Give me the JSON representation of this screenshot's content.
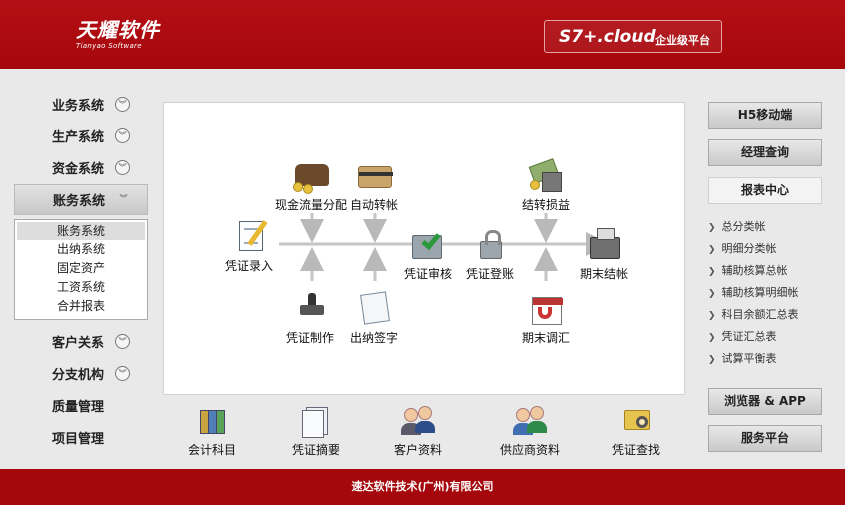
{
  "header": {
    "logo_cn": "天耀软件",
    "logo_en": "Tianyao Software",
    "product": "S7+.cloud",
    "platform": "企业级平台"
  },
  "nav": {
    "items": [
      {
        "label": "业务系统"
      },
      {
        "label": "生产系统"
      },
      {
        "label": "资金系统"
      },
      {
        "label": "账务系统",
        "active": true
      },
      {
        "label": "客户关系"
      },
      {
        "label": "分支机构"
      },
      {
        "label": "质量管理"
      },
      {
        "label": "项目管理"
      }
    ],
    "submenu": [
      "账务系统",
      "出纳系统",
      "固定资产",
      "工资系统",
      "合并报表"
    ]
  },
  "flow": {
    "voucher_entry": "凭证录入",
    "cash_flow": "现金流量分配",
    "auto_transfer": "自动转帐",
    "voucher_review": "凭证审核",
    "voucher_post": "凭证登账",
    "carry_forward": "结转损益",
    "period_close": "期末结帐",
    "voucher_make": "凭证制作",
    "cashier_sign": "出纳签字",
    "period_adjust": "期末调汇"
  },
  "quick": [
    "会计科目",
    "凭证摘要",
    "客户资料",
    "供应商资料",
    "凭证查找"
  ],
  "right": {
    "h5": "H5移动端",
    "manager": "经理查询",
    "report_center": "报表中心",
    "reports": [
      "总分类帐",
      "明细分类帐",
      "辅助核算总帐",
      "辅助核算明细帐",
      "科目余额汇总表",
      "凭证汇总表",
      "试算平衡表"
    ],
    "browser_app": "浏览器 & APP",
    "service": "服务平台"
  },
  "footer": "速达软件技术(广州)有限公司"
}
